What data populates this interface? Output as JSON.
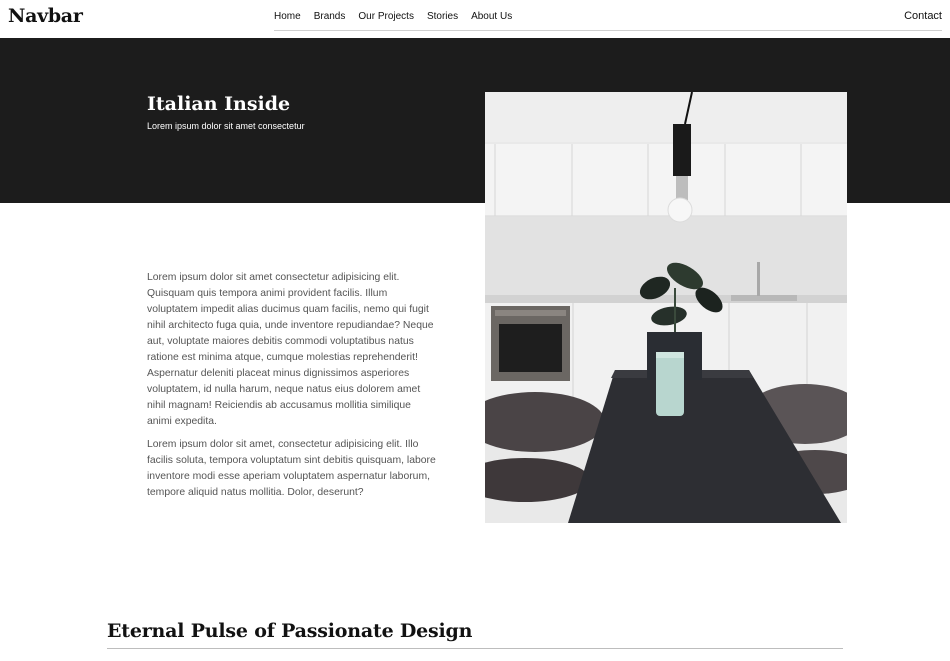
{
  "navbar": {
    "brand": "Navbar",
    "links": [
      "Home",
      "Brands",
      "Our Projects",
      "Stories",
      "About Us"
    ],
    "contact": "Contact"
  },
  "hero": {
    "title": "Italian Inside",
    "subtitle": "Lorem ipsum dolor sit amet consectetur"
  },
  "content": {
    "paragraphs": [
      "Lorem ipsum dolor sit amet consectetur adipisicing elit. Quisquam quis tempora animi provident facilis. Illum voluptatem impedit alias ducimus quam facilis, nemo qui fugit nihil architecto fuga quia, unde inventore repudiandae? Neque aut, voluptate maiores debitis commodi voluptatibus natus ratione est minima atque, cumque molestias reprehenderit! Aspernatur deleniti placeat minus dignissimos asperiores voluptatem, id nulla harum, neque natus eius dolorem amet nihil magnam! Reiciendis ab accusamus mollitia similique animi expedita.",
      "Lorem ipsum dolor sit amet, consectetur adipisicing elit. Illo facilis soluta, tempora voluptatum sint debitis quisquam, labore inventore modi esse aperiam voluptatem aspernatur laborum, tempore aliquid natus mollitia. Dolor, deserunt?"
    ]
  },
  "section": {
    "title": "Eternal Pulse of Passionate Design"
  }
}
